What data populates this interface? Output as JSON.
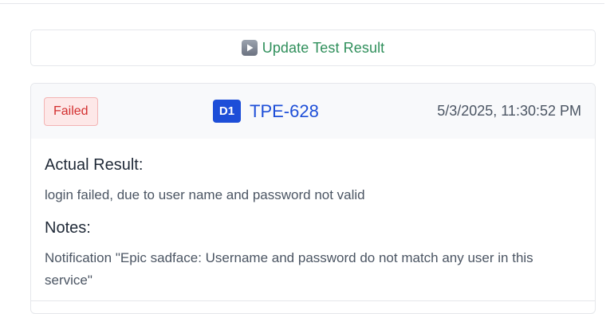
{
  "update_button": {
    "icon": "play-icon",
    "label": "Update Test Result"
  },
  "result_card": {
    "status": "Failed",
    "issue_type": "D1",
    "issue_key": "TPE-628",
    "timestamp": "5/3/2025, 11:30:52 PM",
    "actual_result_title": "Actual Result:",
    "actual_result_text": "login failed, due to user name and password not valid",
    "notes_title": "Notes:",
    "notes_text": "Notification \"Epic sadface: Username and password do not match any user in this service\""
  },
  "colors": {
    "failed_text": "#d32f2f",
    "failed_bg": "#fde8e8",
    "update_text": "#2f8f5b",
    "issue_accent": "#1d4ed8"
  }
}
